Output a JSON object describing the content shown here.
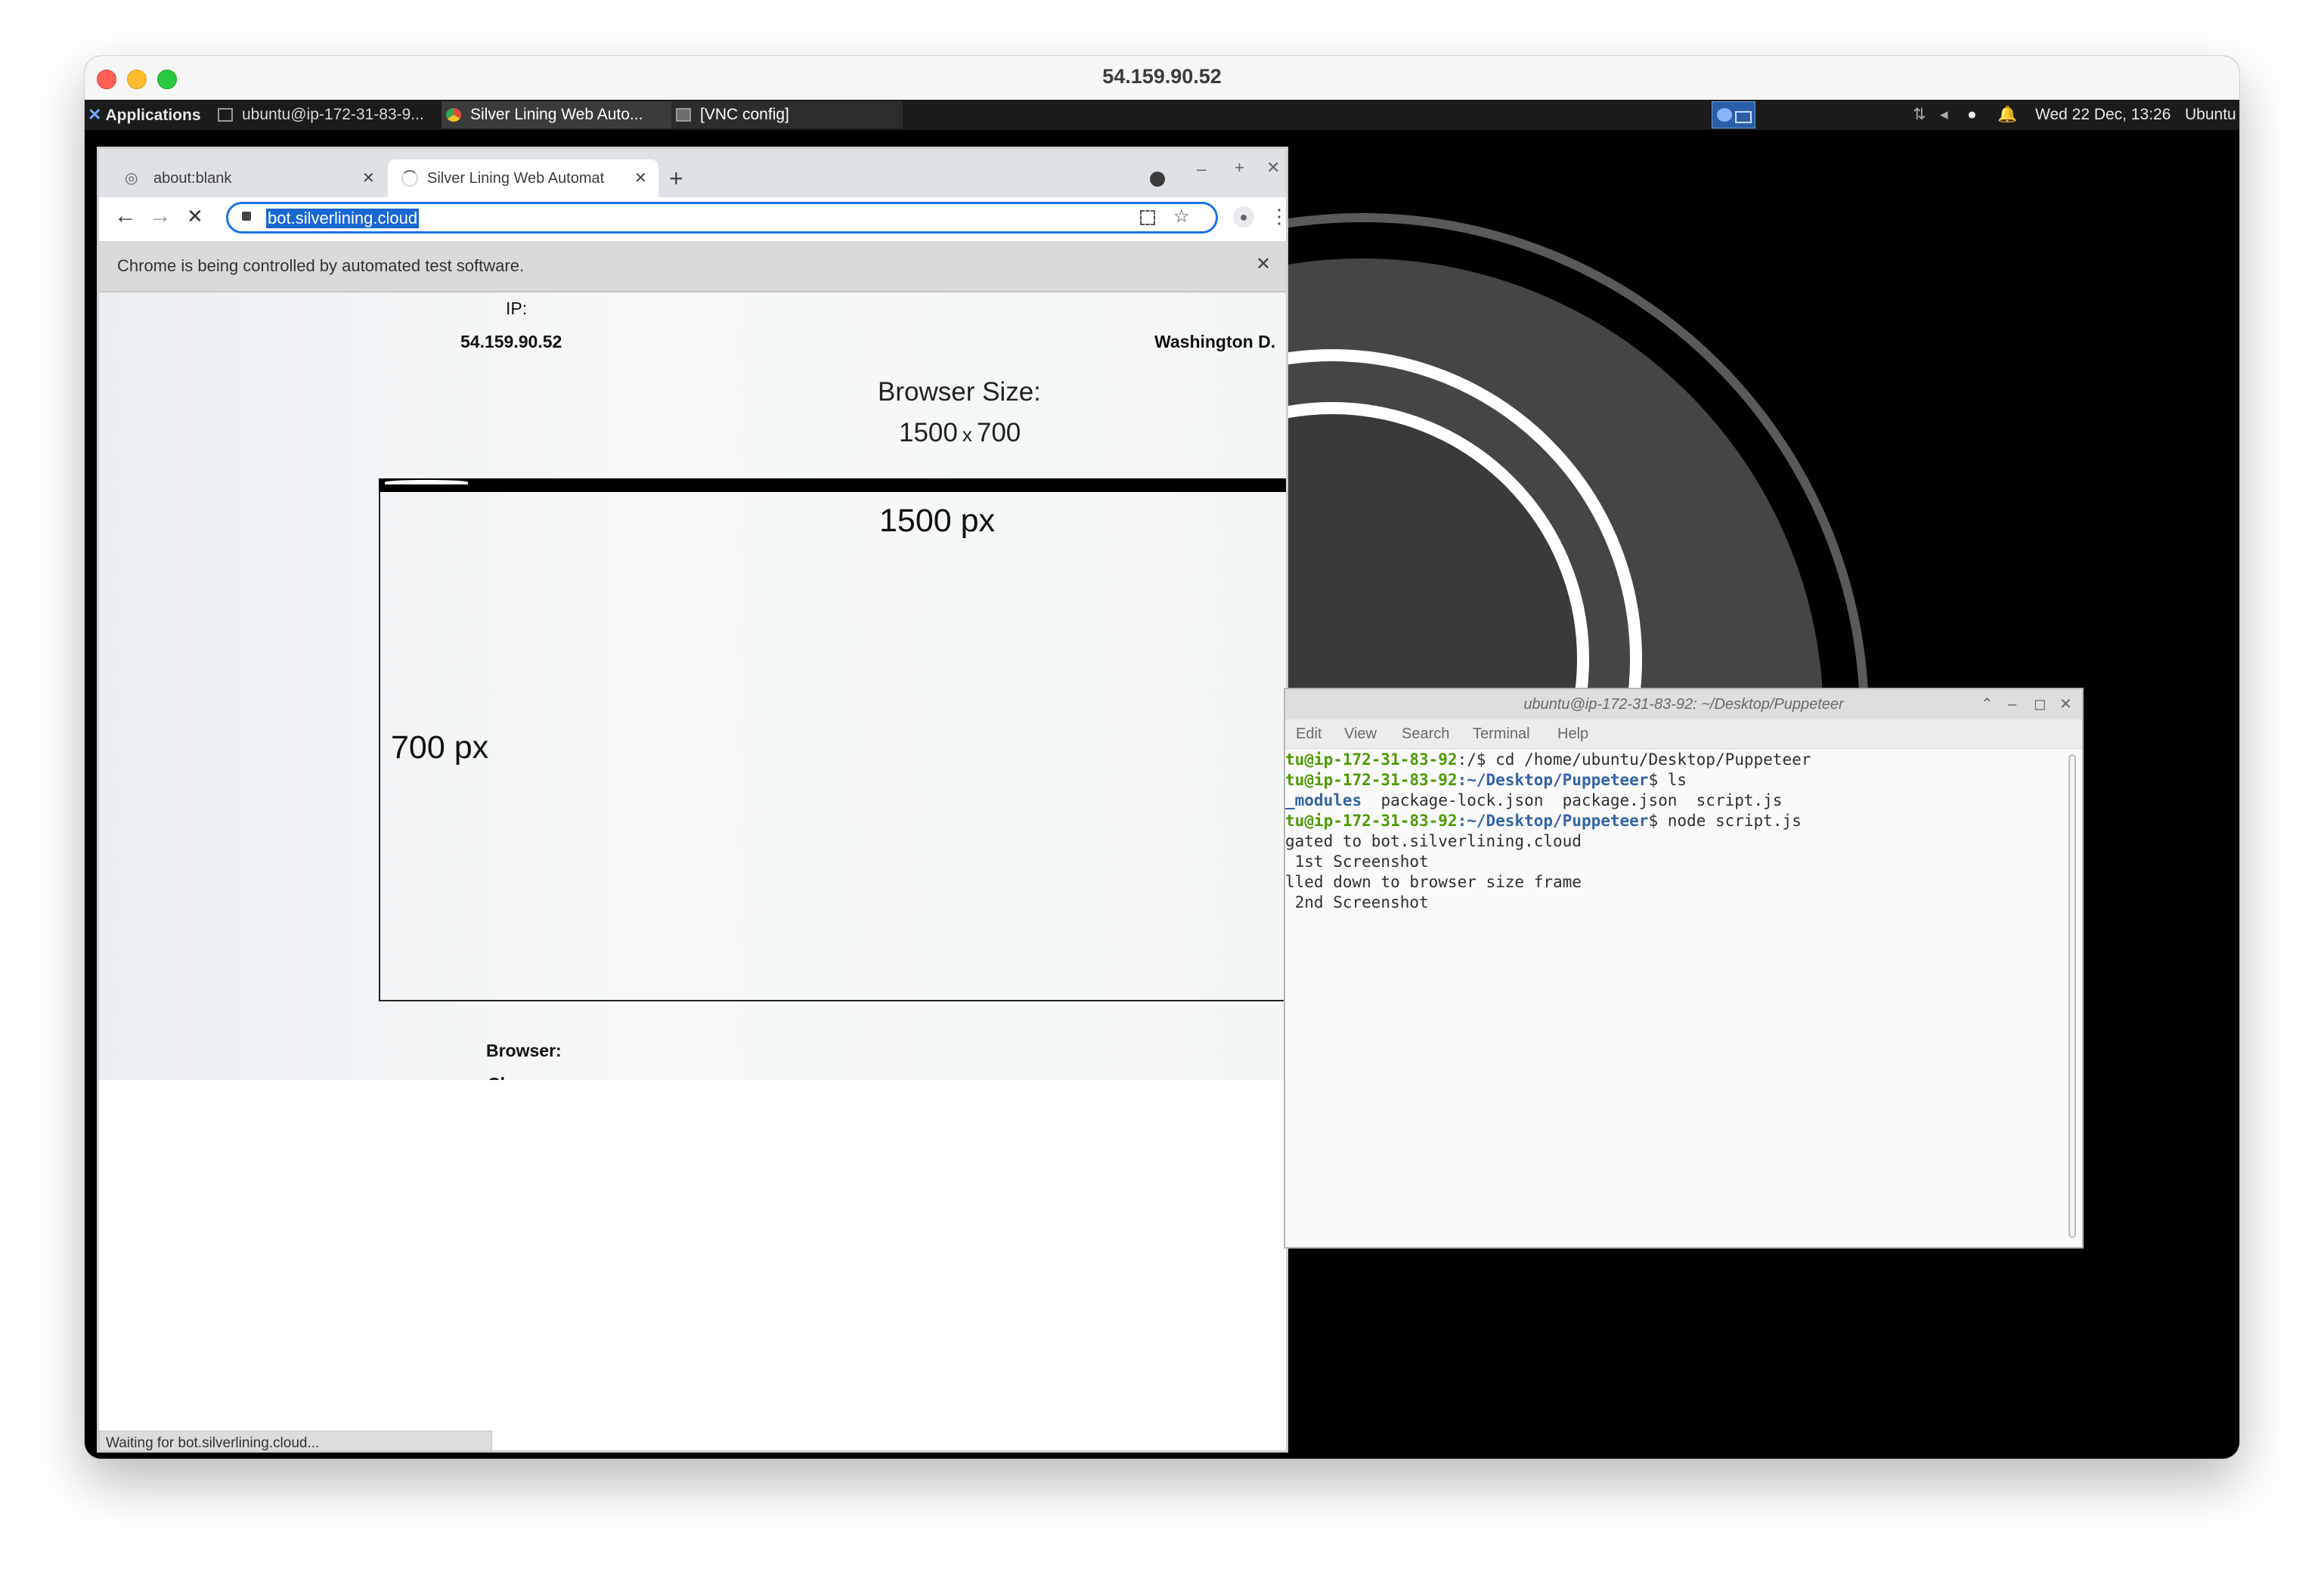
{
  "host_window": {
    "title": "54.159.90.52"
  },
  "panel": {
    "applications_label": "Applications :",
    "tasks": [
      {
        "label": "ubuntu@ip-172-31-83-9...",
        "icon": "terminal-icon"
      },
      {
        "label": "Silver Lining Web Auto...",
        "icon": "chrome-icon"
      },
      {
        "label": "[VNC config]",
        "icon": "window-icon"
      }
    ],
    "datetime": "Wed 22 Dec, 13:26",
    "user": "Ubuntu"
  },
  "browser": {
    "tabs": [
      {
        "title": "about:blank"
      },
      {
        "title": "Silver Lining Web Automat"
      }
    ],
    "url": "bot.silverlining.cloud",
    "infobar_text": "Chrome is being controlled by automated test software.",
    "status_text": "Waiting for bot.silverlining.cloud..."
  },
  "page": {
    "ip_label": "IP:",
    "ip_value": "54.159.90.52",
    "location_value": "Washington D.",
    "size_heading": "Browser Size:",
    "size_w": "1500",
    "size_x": "x",
    "size_h": "700",
    "frame_width_label": "1500 px",
    "frame_height_label": "700 px",
    "browser_label": "Browser:",
    "browser_value": "Chrome"
  },
  "terminal": {
    "title": "ubuntu@ip-172-31-83-92: ~/Desktop/Puppeteer",
    "menu": [
      "Edit",
      "View",
      "Search",
      "Terminal",
      "Help"
    ],
    "lines": [
      {
        "prompt_user": "tu@ip-172-31-83-92",
        "prompt_path": ":/",
        "command": "$ cd /home/ubuntu/Desktop/Puppeteer"
      },
      {
        "prompt_user": "tu@ip-172-31-83-92",
        "prompt_path": ":~/Desktop/Puppeteer",
        "command": "$ ls"
      },
      {
        "dir_name": "_modules",
        "output": "  package-lock.json  package.json  script.js"
      },
      {
        "prompt_user": "tu@ip-172-31-83-92",
        "prompt_path": ":~/Desktop/Puppeteer",
        "command": "$ node script.js"
      },
      {
        "output": "gated to bot.silverlining.cloud"
      },
      {
        "output": " 1st Screenshot"
      },
      {
        "output": "lled down to browser size frame"
      },
      {
        "output": " 2nd Screenshot"
      }
    ]
  },
  "colors": {
    "accent_blue": "#1a73e8",
    "prompt_green": "#4e9a06",
    "prompt_blue": "#3465a4"
  }
}
